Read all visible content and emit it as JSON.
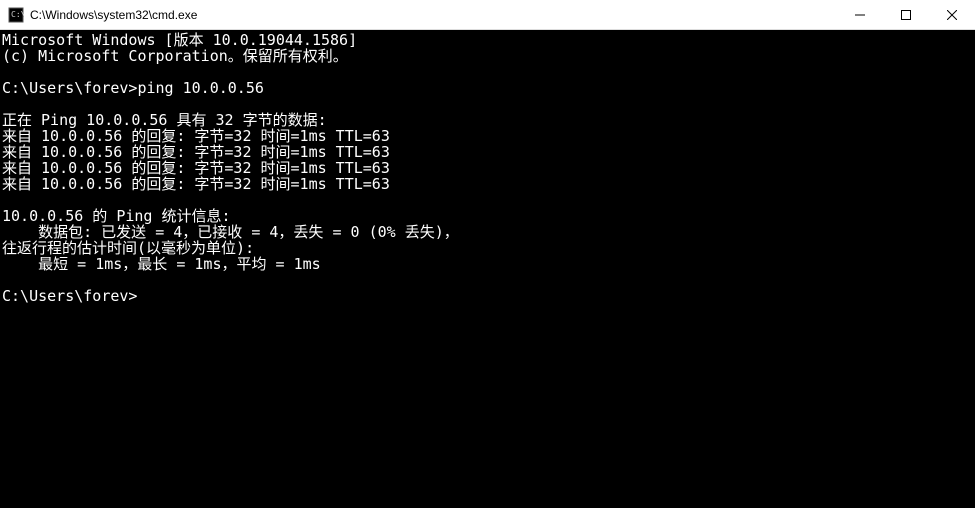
{
  "titlebar": {
    "title": "C:\\Windows\\system32\\cmd.exe"
  },
  "terminal": {
    "line1": "Microsoft Windows [版本 10.0.19044.1586]",
    "line2": "(c) Microsoft Corporation。保留所有权利。",
    "blank1": "",
    "prompt1": "C:\\Users\\forev>ping 10.0.0.56",
    "blank2": "",
    "ping_header": "正在 Ping 10.0.0.56 具有 32 字节的数据:",
    "reply1": "来自 10.0.0.56 的回复: 字节=32 时间=1ms TTL=63",
    "reply2": "来自 10.0.0.56 的回复: 字节=32 时间=1ms TTL=63",
    "reply3": "来自 10.0.0.56 的回复: 字节=32 时间=1ms TTL=63",
    "reply4": "来自 10.0.0.56 的回复: 字节=32 时间=1ms TTL=63",
    "blank3": "",
    "stats_header": "10.0.0.56 的 Ping 统计信息:",
    "stats_packets": "    数据包: 已发送 = 4，已接收 = 4，丢失 = 0 (0% 丢失)，",
    "stats_time_header": "往返行程的估计时间(以毫秒为单位):",
    "stats_time": "    最短 = 1ms，最长 = 1ms，平均 = 1ms",
    "blank4": "",
    "prompt2": "C:\\Users\\forev>"
  }
}
